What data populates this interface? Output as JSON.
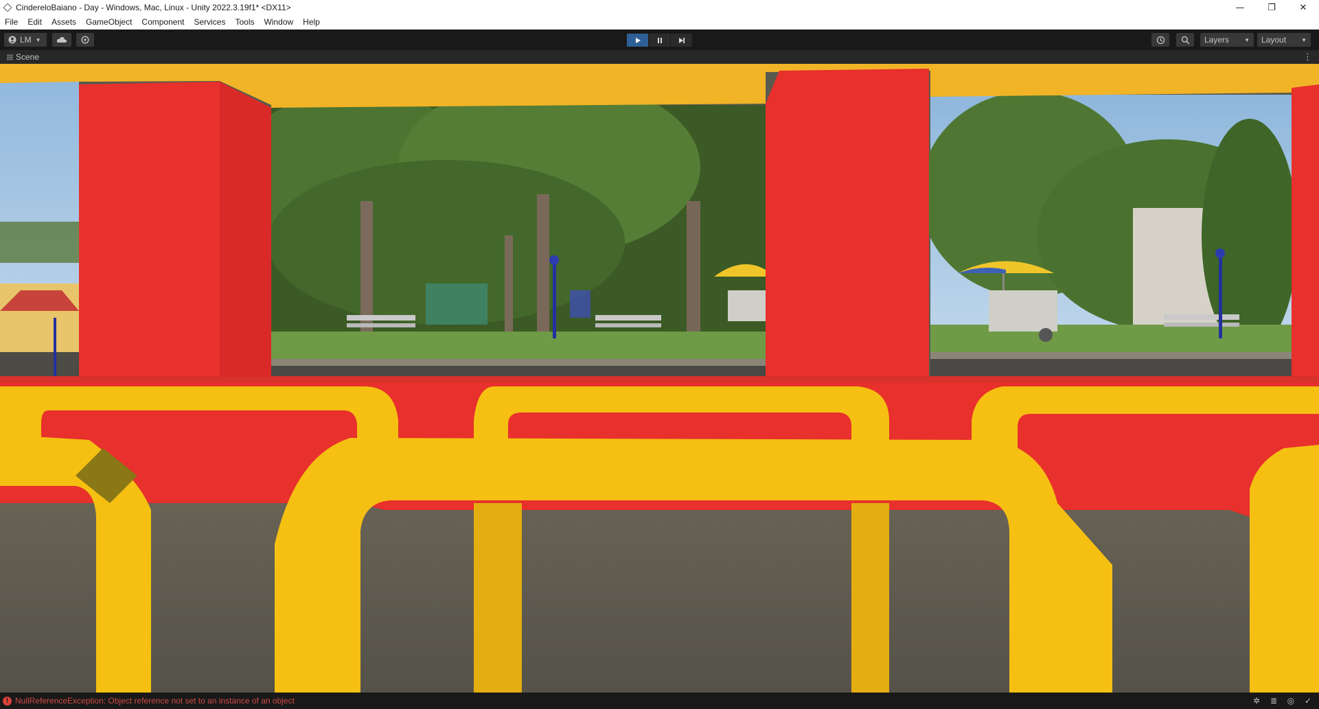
{
  "window": {
    "title": "CindereloBaiano - Day - Windows, Mac, Linux - Unity 2022.3.19f1* <DX11>",
    "controls": {
      "minimize": "—",
      "restore": "❐",
      "close": "✕"
    }
  },
  "menu": [
    "File",
    "Edit",
    "Assets",
    "GameObject",
    "Component",
    "Services",
    "Tools",
    "Window",
    "Help"
  ],
  "toolbar": {
    "account_label": "LM",
    "layers_label": "Layers",
    "layout_label": "Layout",
    "play_state": "playing",
    "icons": [
      "account-icon",
      "cloud-icon",
      "collab-icon",
      "play-icon",
      "pause-icon",
      "step-icon",
      "history-icon",
      "search-icon"
    ]
  },
  "scene_tab": {
    "label": "Scene",
    "more": "⋮"
  },
  "status": {
    "error_message": "NullReferenceException: Object reference not set to an instance of an object",
    "error_glyph": "!"
  },
  "colors": {
    "bus_red": "#e8302c",
    "bus_yellow": "#f1b427",
    "seat_yellow": "#f5c012",
    "play_active": "#2f5f97",
    "error_red": "#cf4b45"
  }
}
